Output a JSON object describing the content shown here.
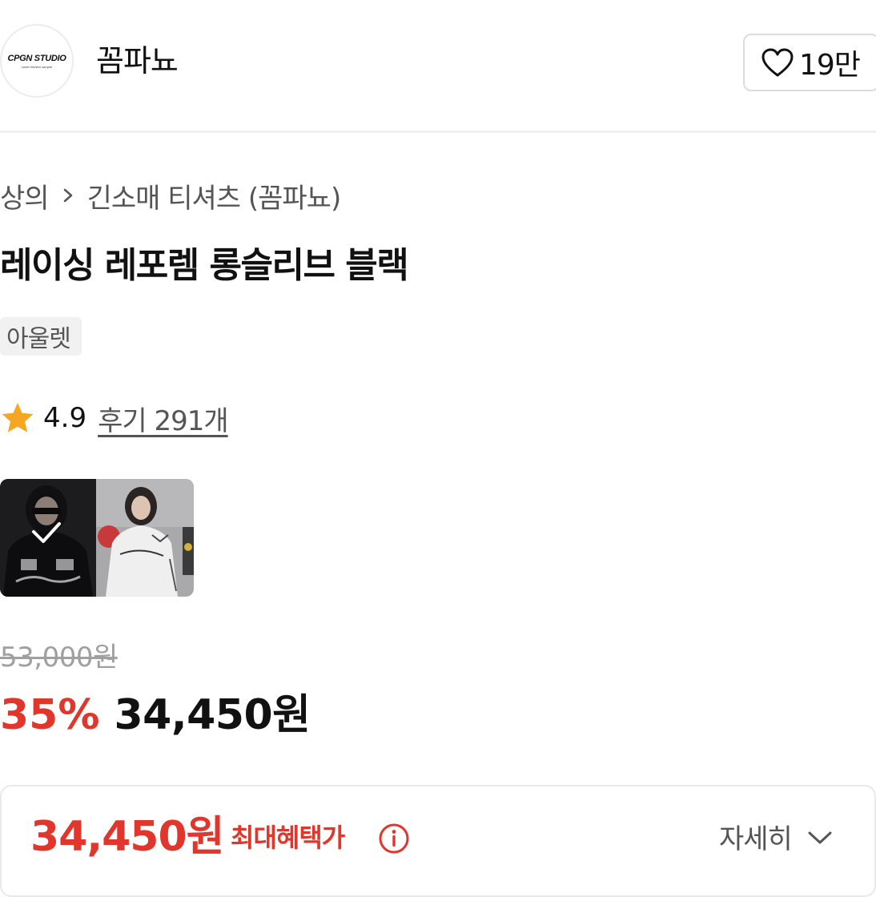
{
  "header": {
    "logo_text": "CPGN STUDIO",
    "logo_subtext": "sober fashion sample",
    "brand_name": "꼼파뇨",
    "like_count": "19만",
    "like_icon": "heart-icon"
  },
  "breadcrumb": {
    "items": [
      "상의",
      "긴소매 티셔츠 (꼼파뇨)"
    ],
    "separator_icon": "chevron-right-icon"
  },
  "product": {
    "title": "레이싱 레포렘 롱슬리브 블랙",
    "tag": "아울렛",
    "rating": "4.9",
    "review_label": "후기 291개",
    "star_color": "#f5a623"
  },
  "pricing": {
    "original_price": "53,000원",
    "discount_rate": "35%",
    "sale_price": "34,450원",
    "accent_color": "#e0362c"
  },
  "benefit": {
    "max_benefit_price": "34,450원",
    "label": "최대혜택가",
    "detail_label": "자세히"
  }
}
